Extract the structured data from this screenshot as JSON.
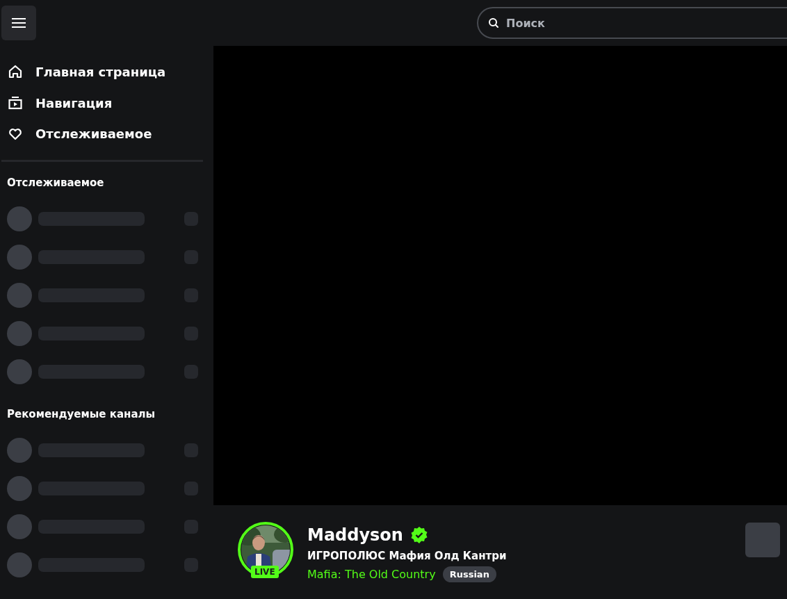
{
  "search": {
    "placeholder": "Поиск"
  },
  "nav": [
    {
      "kind": "home",
      "label": "Главная страница"
    },
    {
      "kind": "browse",
      "label": "Навигация"
    },
    {
      "kind": "heart",
      "label": "Отслеживаемое"
    }
  ],
  "sections": [
    {
      "title": "Отслеживаемое",
      "items": [
        {
          "kind": "skeleton"
        },
        {
          "kind": "skeleton"
        },
        {
          "kind": "skeleton"
        },
        {
          "kind": "skeleton"
        },
        {
          "kind": "skeleton"
        }
      ]
    },
    {
      "title": "Рекомендуемые каналы",
      "items": [
        {
          "kind": "skeleton"
        },
        {
          "kind": "skeleton"
        },
        {
          "kind": "skeleton"
        },
        {
          "kind": "skeleton"
        }
      ]
    }
  ],
  "stream": {
    "avatar": {
      "kind": "picture"
    },
    "live_badge": "LIVE",
    "channel": "Maddyson",
    "verified": true,
    "title": "ИГРОПОЛЮС Мафия Олд Кантри",
    "category": "Mafia: The Old Country",
    "tags": [
      "Russian"
    ]
  }
}
